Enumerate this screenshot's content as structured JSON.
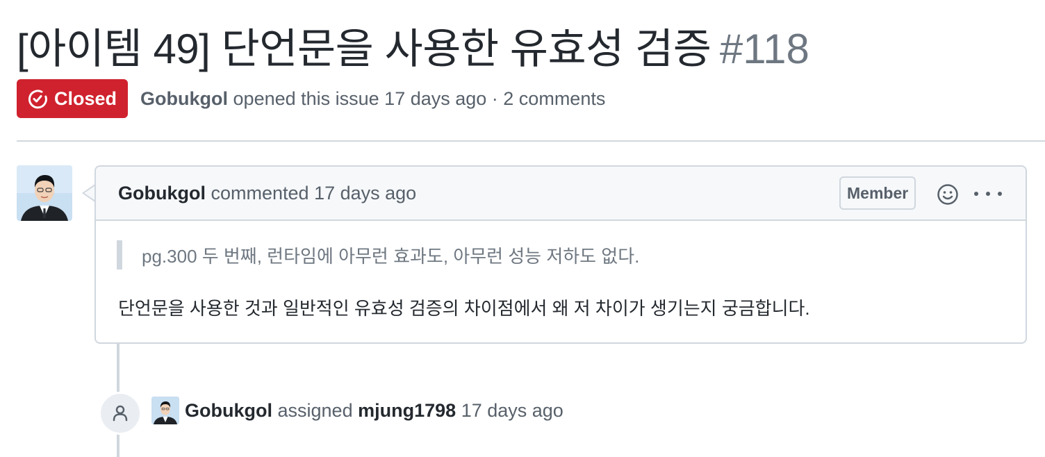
{
  "issue": {
    "title": "[아이템 49] 단언문을 사용한 유효성 검증",
    "number": "#118",
    "state": "Closed",
    "author": "Gobukgol",
    "opened_text": "opened this issue 17 days ago · 2 comments"
  },
  "comment": {
    "author": "Gobukgol",
    "header_text": "commented 17 days ago",
    "role_badge": "Member",
    "quote": "pg.300 두 번째, 런타임에 아무런 효과도, 아무런 성능 저하도 없다.",
    "body": "단언문을 사용한 것과 일반적인 유효성 검증의 차이점에서 왜 저 차이가 생기는지 궁금합니다."
  },
  "event": {
    "actor": "Gobukgol",
    "action": "assigned",
    "assignee": "mjung1798",
    "time": "17 days ago"
  },
  "colors": {
    "closed_red": "#cf222e",
    "border": "#d0d7de",
    "muted_text": "#57606a",
    "header_bg": "#f6f8fa"
  },
  "icons": {
    "state": "issue-closed-icon",
    "reaction": "smiley-icon",
    "menu": "kebab-horizontal-icon",
    "event": "person-icon"
  }
}
